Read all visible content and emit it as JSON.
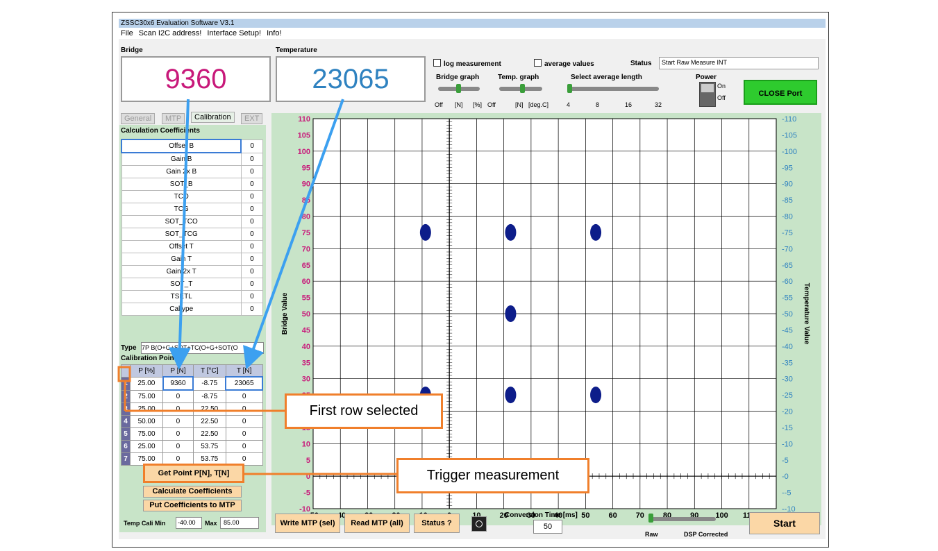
{
  "window": {
    "title": "ZSSC30x6 Evaluation Software V3.1"
  },
  "menu": [
    "File",
    "Scan I2C address!",
    "Interface Setup!",
    "Info!"
  ],
  "bridge": {
    "label": "Bridge",
    "value": "9360"
  },
  "temperature": {
    "label": "Temperature",
    "value": "23065"
  },
  "controls": {
    "log_measurement": "log measurement",
    "average_values": "average values",
    "status_label": "Status",
    "status_value": "Start Raw Measure INT",
    "bridge_graph": "Bridge graph",
    "temp_graph": "Temp. graph",
    "avg_length": "Select average length",
    "power": "Power",
    "on": "On",
    "off_label": "Off",
    "close_port": "CLOSE Port",
    "ticks_bridge": [
      "Off",
      "[N]",
      "[%]"
    ],
    "ticks_temp": [
      "Off",
      "[N]",
      "[deg.C]"
    ],
    "ticks_avg": [
      "4",
      "8",
      "16",
      "32"
    ]
  },
  "tabs": [
    "General",
    "MTP",
    "Calibration",
    "EXT"
  ],
  "coefficients": {
    "title": "Calculation Coefficients",
    "rows": [
      [
        "Offset B",
        "0"
      ],
      [
        "Gain B",
        "0"
      ],
      [
        "Gain 2x B",
        "0"
      ],
      [
        "SOT_B",
        "0"
      ],
      [
        "TCO",
        "0"
      ],
      [
        "TCG",
        "0"
      ],
      [
        "SOT_TCO",
        "0"
      ],
      [
        "SOT_TCG",
        "0"
      ],
      [
        "Offset T",
        "0"
      ],
      [
        "Gain T",
        "0"
      ],
      [
        "Gain 2x T",
        "0"
      ],
      [
        "SOT_T",
        "0"
      ],
      [
        "TSETL",
        "0"
      ],
      [
        "Caltype",
        "0"
      ]
    ]
  },
  "type": {
    "label": "Type",
    "value": "7P B(O+G+SOT+TC(O+G+SOT(O"
  },
  "calpoints": {
    "title": "Calibration Points",
    "headers": [
      "P [%]",
      "P [N]",
      "T [°C]",
      "T [N]"
    ],
    "rows": [
      [
        "1",
        "25.00",
        "9360",
        "-8.75",
        "23065"
      ],
      [
        "2",
        "75.00",
        "0",
        "-8.75",
        "0"
      ],
      [
        "3",
        "25.00",
        "0",
        "22.50",
        "0"
      ],
      [
        "4",
        "50.00",
        "0",
        "22.50",
        "0"
      ],
      [
        "5",
        "75.00",
        "0",
        "22.50",
        "0"
      ],
      [
        "6",
        "25.00",
        "0",
        "53.75",
        "0"
      ],
      [
        "7",
        "75.00",
        "0",
        "53.75",
        "0"
      ]
    ]
  },
  "buttons": {
    "get_point": "Get Point P[N], T[N]",
    "calc": "Calculate Coefficients",
    "put": "Put Coefficients to MTP",
    "write_mtp": "Write MTP (sel)",
    "read_mtp": "Read MTP (all)",
    "status": "Status ?",
    "start": "Start"
  },
  "tempcali": {
    "min_label": "Temp Cali Min",
    "min": "-40.00",
    "max_label": "Max",
    "max": "85.00"
  },
  "conversion": {
    "label": "Conversion Time [ms]",
    "value": "50"
  },
  "mode": {
    "raw": "Raw",
    "dsp": "DSP Corrected"
  },
  "callouts": {
    "first_row": "First row selected",
    "trigger": "Trigger measurement"
  },
  "chart_data": {
    "type": "scatter",
    "ylabel": "Bridge Value",
    "y2label": "Temperature Value",
    "xlim": [
      -50,
      120
    ],
    "ylim": [
      -10,
      110
    ],
    "xticks": [
      "-50",
      "-40",
      "-30",
      "-20",
      "-10",
      "0",
      "10",
      "20",
      "30",
      "40",
      "50",
      "60",
      "70",
      "80",
      "90",
      "100",
      "110",
      "120"
    ],
    "yticks": [
      "-10",
      "-5",
      "0",
      "5",
      "10",
      "15",
      "20",
      "25",
      "30",
      "35",
      "40",
      "45",
      "50",
      "55",
      "60",
      "65",
      "70",
      "75",
      "80",
      "85",
      "90",
      "95",
      "100",
      "105",
      "110"
    ],
    "points": [
      {
        "x": -8.75,
        "y": 75
      },
      {
        "x": 22.5,
        "y": 75
      },
      {
        "x": 53.75,
        "y": 75
      },
      {
        "x": 22.5,
        "y": 50
      },
      {
        "x": -8.75,
        "y": 25
      },
      {
        "x": 22.5,
        "y": 25
      },
      {
        "x": 53.75,
        "y": 25
      }
    ],
    "grid": true,
    "point_color": "#0d1d8a"
  }
}
